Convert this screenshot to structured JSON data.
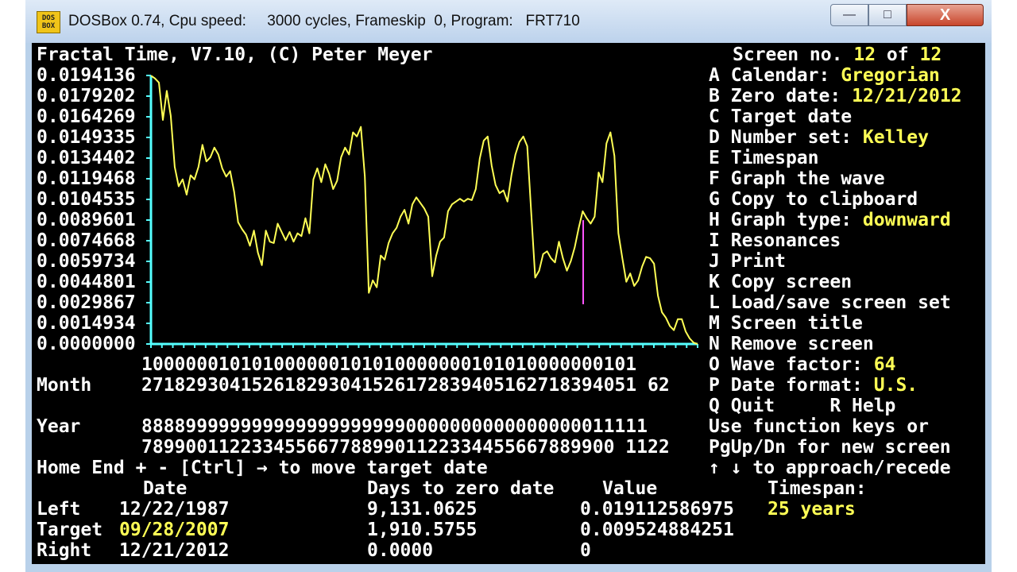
{
  "window": {
    "icon_text_top": "DOS",
    "icon_text_bottom": "BOX",
    "title": "DOSBox 0.74, Cpu speed:     3000 cycles, Frameskip  0, Program:   FRT710",
    "min_glyph": "—",
    "max_glyph": "□",
    "close_glyph": "X"
  },
  "header": {
    "program_title": "Fractal Time, V7.10, (C) Peter Meyer",
    "screen_label": "Screen no.",
    "screen_no": "12",
    "screen_of": "of",
    "screen_total": "12"
  },
  "y_labels": [
    "0.0194136",
    "0.0179202",
    "0.0164269",
    "0.0149335",
    "0.0134402",
    "0.0119468",
    "0.0104535",
    "0.0089601",
    "0.0074668",
    "0.0059734",
    "0.0044801",
    "0.0029867",
    "0.0014934",
    "0.0000000"
  ],
  "axis": {
    "row1": "100000010101000000101010000000101010000000101",
    "month_label": "Month",
    "month_row": "271829304152618293041526172839405162718394051 62",
    "year_label": "Year",
    "year_row1": "8888999999999999999999990000000000000000011111",
    "year_row2": "7899001122334556677889901122334455667889900 1122"
  },
  "menu": [
    {
      "key": "A",
      "label": "Calendar:",
      "value": "Gregorian"
    },
    {
      "key": "B",
      "label": "Zero date:",
      "value": "12/21/2012"
    },
    {
      "key": "C",
      "label": "Target date",
      "value": ""
    },
    {
      "key": "D",
      "label": "Number set:",
      "value": "Kelley"
    },
    {
      "key": "E",
      "label": "Timespan",
      "value": ""
    },
    {
      "key": "F",
      "label": "Graph the wave",
      "value": ""
    },
    {
      "key": "G",
      "label": "Copy to clipboard",
      "value": ""
    },
    {
      "key": "H",
      "label": "Graph type:",
      "value": "downward"
    },
    {
      "key": "I",
      "label": "Resonances",
      "value": ""
    },
    {
      "key": "J",
      "label": "Print",
      "value": ""
    },
    {
      "key": "K",
      "label": "Copy screen",
      "value": ""
    },
    {
      "key": "L",
      "label": "Load/save screen set",
      "value": ""
    },
    {
      "key": "M",
      "label": "Screen title",
      "value": ""
    },
    {
      "key": "N",
      "label": "Remove screen",
      "value": ""
    },
    {
      "key": "O",
      "label": "Wave factor:",
      "value": "64"
    },
    {
      "key": "P",
      "label": "Date format:",
      "value": "U.S."
    }
  ],
  "quit_help": "Q Quit     R Help",
  "hint1": "Use function keys or",
  "hint2": "PgUp/Dn for new screen",
  "hint3": "↑ ↓ to approach/recede",
  "nav_hint": "Home End + - [Ctrl] → to move target date",
  "table": {
    "col_date": "Date",
    "col_days": "Days to zero date",
    "col_value": "Value",
    "timespan_label": "Timespan:",
    "timespan_value": "25 years",
    "rows": [
      {
        "label": "Left",
        "date": "12/22/1987",
        "days": "9,131.0625",
        "value": "0.019112586975"
      },
      {
        "label": "Target",
        "date": "09/28/2007",
        "days": "1,910.5755",
        "value": "0.009524884251"
      },
      {
        "label": "Right",
        "date": "12/21/2012",
        "days": "0.0000",
        "value": "0"
      }
    ]
  },
  "chart_data": {
    "type": "line",
    "x_start": "12/22/1987",
    "x_end": "12/21/2012",
    "ylim": [
      0,
      0.0194136
    ],
    "target_x": "09/28/2007",
    "target_value": 0.009524884251,
    "colors": {
      "wave": "#ffff55",
      "axis": "#55ffff",
      "target": "#ff55ff"
    },
    "values": [
      0.0194,
      0.0192,
      0.0189,
      0.0162,
      0.0183,
      0.0165,
      0.0128,
      0.0114,
      0.0119,
      0.0108,
      0.0122,
      0.0119,
      0.0128,
      0.0144,
      0.0132,
      0.0135,
      0.0142,
      0.0137,
      0.0127,
      0.0121,
      0.0125,
      0.011,
      0.0088,
      0.0083,
      0.0079,
      0.0071,
      0.0082,
      0.0066,
      0.0057,
      0.0082,
      0.0074,
      0.0073,
      0.0087,
      0.0081,
      0.0075,
      0.0081,
      0.0074,
      0.008,
      0.0078,
      0.0091,
      0.008,
      0.0119,
      0.0127,
      0.0117,
      0.013,
      0.0123,
      0.0112,
      0.0118,
      0.0135,
      0.0142,
      0.0137,
      0.0153,
      0.015,
      0.0157,
      0.0121,
      0.0037,
      0.0046,
      0.0041,
      0.0064,
      0.0061,
      0.0073,
      0.008,
      0.0084,
      0.0092,
      0.0097,
      0.0087,
      0.0101,
      0.0106,
      0.0102,
      0.0098,
      0.0092,
      0.0049,
      0.0064,
      0.0074,
      0.0077,
      0.0096,
      0.0101,
      0.0103,
      0.0105,
      0.0103,
      0.0105,
      0.0104,
      0.0112,
      0.0134,
      0.0147,
      0.015,
      0.0129,
      0.0115,
      0.0109,
      0.0111,
      0.0103,
      0.0122,
      0.0137,
      0.0146,
      0.015,
      0.0143,
      0.0095,
      0.0048,
      0.0053,
      0.0065,
      0.0067,
      0.0062,
      0.0059,
      0.0074,
      0.0062,
      0.0053,
      0.006,
      0.007,
      0.0084,
      0.0096,
      0.0091,
      0.0087,
      0.0092,
      0.0124,
      0.0117,
      0.0145,
      0.0153,
      0.0136,
      0.008,
      0.0062,
      0.0045,
      0.0051,
      0.0042,
      0.0046,
      0.0056,
      0.0063,
      0.0062,
      0.0058,
      0.0035,
      0.0023,
      0.0019,
      0.0013,
      0.001,
      0.0018,
      0.0018,
      0.0009,
      0.0004,
      0.0001,
      0.0
    ]
  }
}
